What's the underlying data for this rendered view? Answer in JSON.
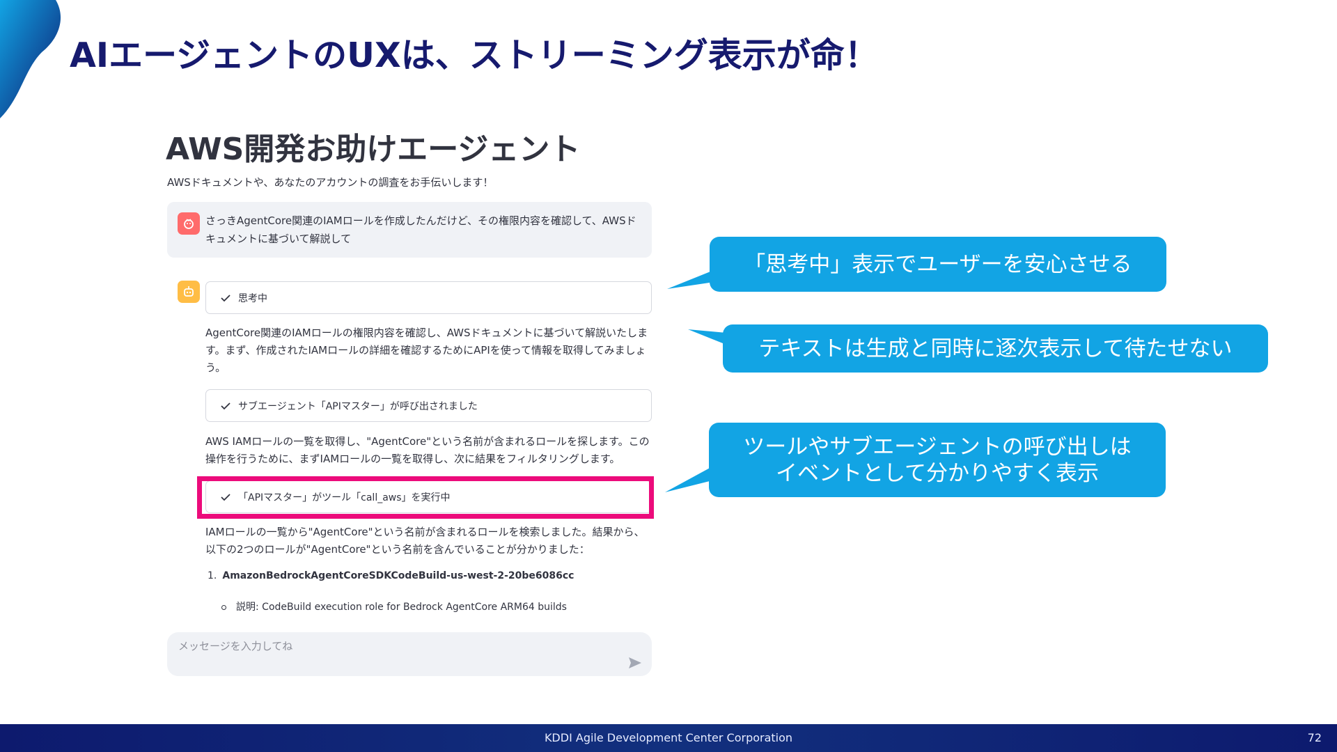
{
  "slide": {
    "title": "AIエージェントのUXは、ストリーミング表示が命！"
  },
  "app": {
    "title": "AWS開発お助けエージェント",
    "subtitle": "AWSドキュメントや、あなたのアカウントの調査をお手伝いします！",
    "user_message": "さっきAgentCore関連のIAMロールを作成したんだけど、その権限内容を確認して、AWSドキュメントに基づいて解説して",
    "statuses": [
      {
        "label": "思考中"
      },
      {
        "label": "サブエージェント「APIマスター」が呼び出されました"
      },
      {
        "label": "「APIマスター」がツール「call_aws」を実行中"
      }
    ],
    "responses": [
      "AgentCore関連のIAMロールの権限内容を確認し、AWSドキュメントに基づいて解説いたします。まず、作成されたIAMロールの詳細を確認するためにAPIを使って情報を取得してみましょう。",
      "AWS IAMロールの一覧を取得し、\"AgentCore\"という名前が含まれるロールを探します。この操作を行うために、まずIAMロールの一覧を取得し、次に結果をフィルタリングします。",
      "IAMロールの一覧から\"AgentCore\"という名前が含まれるロールを検索しました。結果から、以下の2つのロールが\"AgentCore\"という名前を含んでいることが分かりました："
    ],
    "list": {
      "number": "1.",
      "item": "AmazonBedrockAgentCoreSDKCodeBuild-us-west-2-20be6086cc",
      "sub_item": "説明: CodeBuild execution role for Bedrock AgentCore ARM64 builds"
    },
    "input_placeholder": "メッセージを入力してね"
  },
  "callouts": {
    "thinking": "「思考中」表示でユーザーを安心させる",
    "streaming": "テキストは生成と同時に逐次表示して待たせない",
    "tools_line1": "ツールやサブエージェントの呼び出しは",
    "tools_line2": "イベントとして分かりやすく表示"
  },
  "footer": {
    "company": "KDDI Agile Development Center Corporation",
    "page": "72"
  },
  "colors": {
    "title": "#161a6e",
    "callout": "#12a4e4",
    "highlight": "#ec0b7b",
    "footer": "#0d1a6e"
  }
}
